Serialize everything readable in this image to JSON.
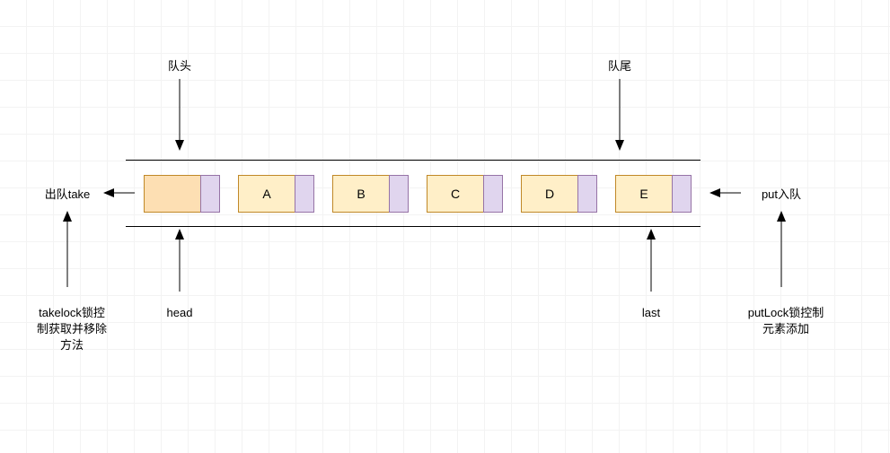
{
  "labels": {
    "queue_head_cn": "队头",
    "queue_tail_cn": "队尾",
    "take_label": "出队take",
    "put_label": "put入队",
    "head_ptr": "head",
    "last_ptr": "last",
    "take_lock_desc": "takelock锁控\n制获取并移除\n方法",
    "put_lock_desc": "putLock锁控制\n元素添加"
  },
  "nodes": [
    {
      "id": "n0",
      "text": "",
      "kind": "head"
    },
    {
      "id": "n1",
      "text": "A",
      "kind": "data"
    },
    {
      "id": "n2",
      "text": "B",
      "kind": "data"
    },
    {
      "id": "n3",
      "text": "C",
      "kind": "data"
    },
    {
      "id": "n4",
      "text": "D",
      "kind": "data"
    },
    {
      "id": "n5",
      "text": "E",
      "kind": "data"
    }
  ],
  "chart_data": {
    "type": "diagram",
    "description": "Linked blocking queue structure with head sentinel and elements A–E. take() removes from head under takeLock; put() appends at tail under putLock.",
    "elements": [
      "A",
      "B",
      "C",
      "D",
      "E"
    ],
    "pointers": {
      "head": "sentinel(empty)",
      "last": "E"
    },
    "operations": {
      "take": {
        "side": "head",
        "lock": "takeLock"
      },
      "put": {
        "side": "tail",
        "lock": "putLock"
      }
    }
  }
}
